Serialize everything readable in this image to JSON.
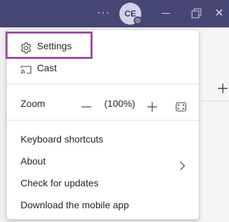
{
  "titlebar": {
    "more_label": "···",
    "avatar_initials": "CE",
    "close_glyph": "✕"
  },
  "menu": {
    "settings": "Settings",
    "cast": "Cast",
    "zoom_label": "Zoom",
    "zoom_value": "(100%)",
    "keyboard_shortcuts": "Keyboard shortcuts",
    "about": "About",
    "check_updates": "Check for updates",
    "download_mobile": "Download the mobile app"
  },
  "icons": {
    "settings": "gear-icon",
    "cast": "cast-icon",
    "zoom_out": "minus-icon",
    "zoom_in": "plus-icon",
    "fullscreen": "fullscreen-icon",
    "about_submenu": "chevron-right-icon"
  },
  "colors": {
    "titlebar": "#464775",
    "highlight": "#9b4f9e"
  }
}
